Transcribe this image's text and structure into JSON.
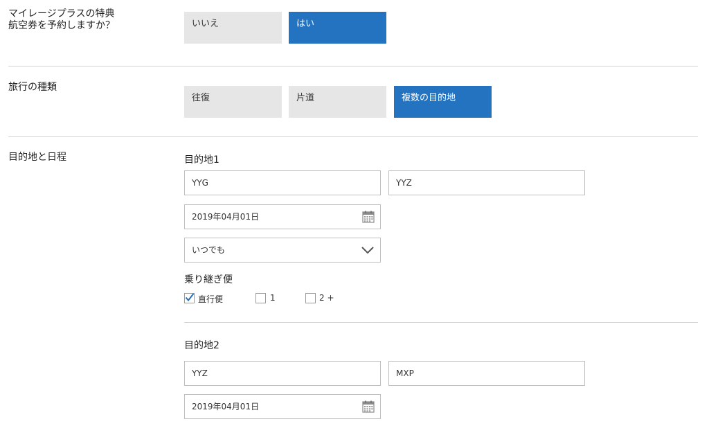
{
  "award": {
    "label": "マイレージプラスの特典航空券を予約しますか？",
    "options": [
      {
        "label": "いいえ",
        "selected": false
      },
      {
        "label": "はい",
        "selected": true
      }
    ]
  },
  "trip_type": {
    "label": "旅行の種類",
    "options": [
      {
        "label": "往復",
        "selected": false
      },
      {
        "label": "片道",
        "selected": false
      },
      {
        "label": "複数の目的地",
        "selected": true
      }
    ]
  },
  "itinerary": {
    "label": "目的地と日程",
    "segments": [
      {
        "heading": "目的地1",
        "from": "YYG",
        "to": "YYZ",
        "date": "2019年04月01日",
        "time": "いつでも",
        "connections": {
          "label": "乗り継ぎ便",
          "options": [
            {
              "label": "直行便",
              "checked": true
            },
            {
              "label": "1",
              "checked": false
            },
            {
              "label": "2 +",
              "checked": false
            }
          ]
        }
      },
      {
        "heading": "目的地2",
        "from": "YYZ",
        "to": "MXP",
        "date": "2019年04月01日"
      }
    ]
  },
  "colors": {
    "selected": "#2473c1",
    "unselected": "#e6e6e6",
    "checkmark": "#2a6fb8"
  },
  "icons": [
    "calendar-icon",
    "chevron-down-icon",
    "checkmark-icon"
  ]
}
